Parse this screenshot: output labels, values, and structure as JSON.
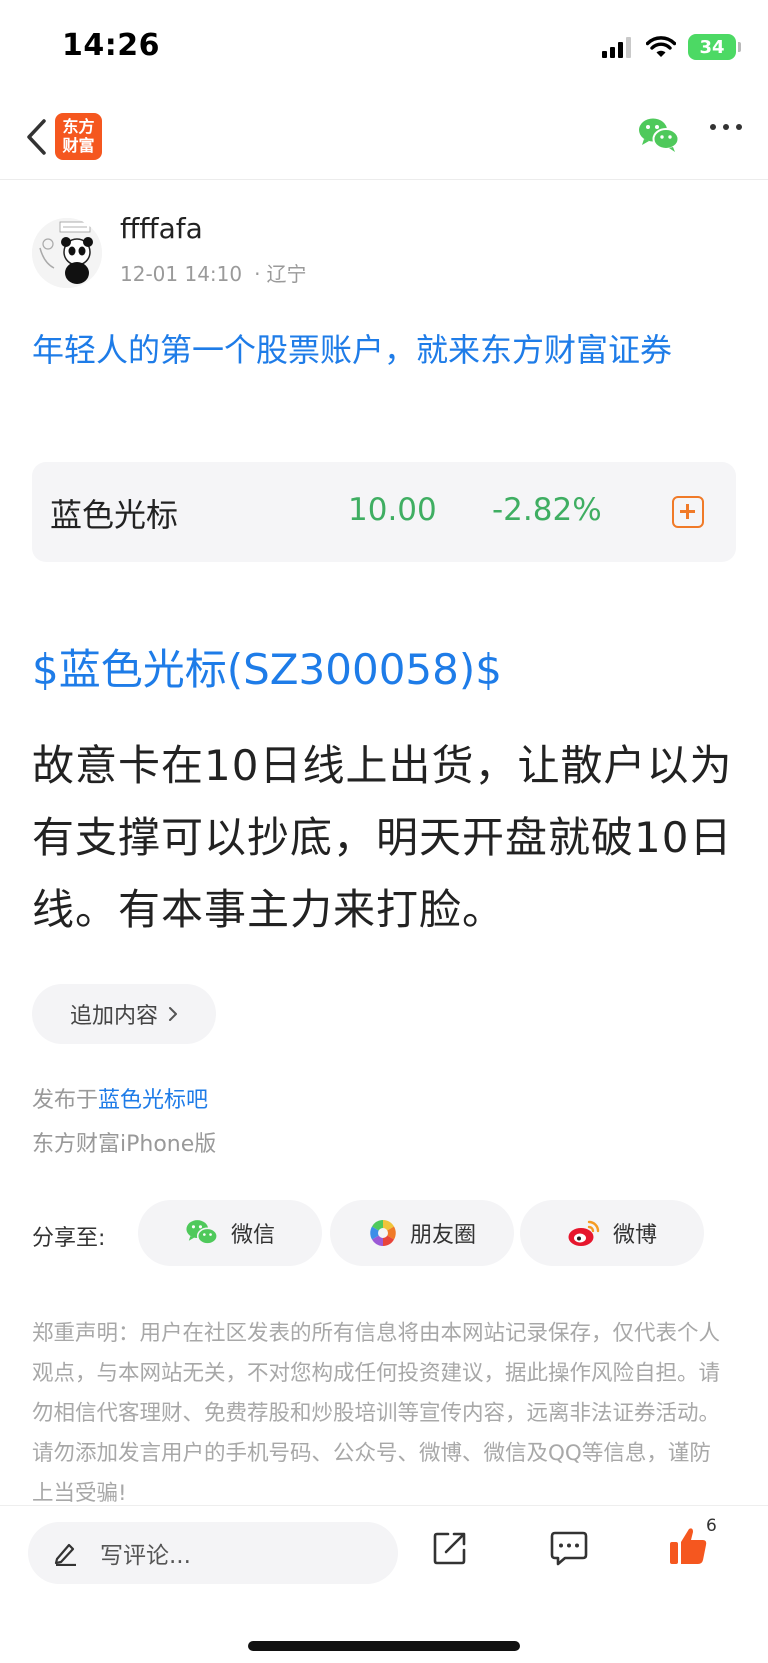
{
  "status_bar": {
    "time": "14:26",
    "battery": "34"
  },
  "nav": {
    "logo_line1": "东方",
    "logo_line2": "财富"
  },
  "author": {
    "name": "ffffafa",
    "time": "12-01 14:10",
    "separator": "·",
    "location": "辽宁"
  },
  "ad": {
    "title": "年轻人的第一个股票账户，就来东方财富证券"
  },
  "stock_card": {
    "name": "蓝色光标",
    "price": "10.00",
    "change": "-2.82%",
    "color": "#3fae62"
  },
  "post": {
    "stock_tag": "$蓝色光标(SZ300058)$",
    "body": "故意卡在10日线上出货，让散户以为有支撑可以抄底，明天开盘就破10日线。有本事主力来打脸。",
    "append_label": "追加内容"
  },
  "meta": {
    "published_prefix": "发布于",
    "bar_link": "蓝色光标吧",
    "client": "东方财富iPhone版"
  },
  "share": {
    "label": "分享至:",
    "wechat": "微信",
    "moments": "朋友圈",
    "weibo": "微博"
  },
  "disclaimer": "郑重声明：用户在社区发表的所有信息将由本网站记录保存，仅代表个人观点，与本网站无关，不对您构成任何投资建议，据此操作风险自担。请勿相信代客理财、免费荐股和炒股培训等宣传内容，远离非法证券活动。请勿添加发言用户的手机号码、公众号、微博、微信及QQ等信息，谨防上当受骗!",
  "bottom_bar": {
    "comment_placeholder": "写评论...",
    "like_count": "6"
  },
  "colors": {
    "brand": "#f5571f",
    "link": "#1e7ce8",
    "down": "#3fae62",
    "like": "#f5571f"
  }
}
